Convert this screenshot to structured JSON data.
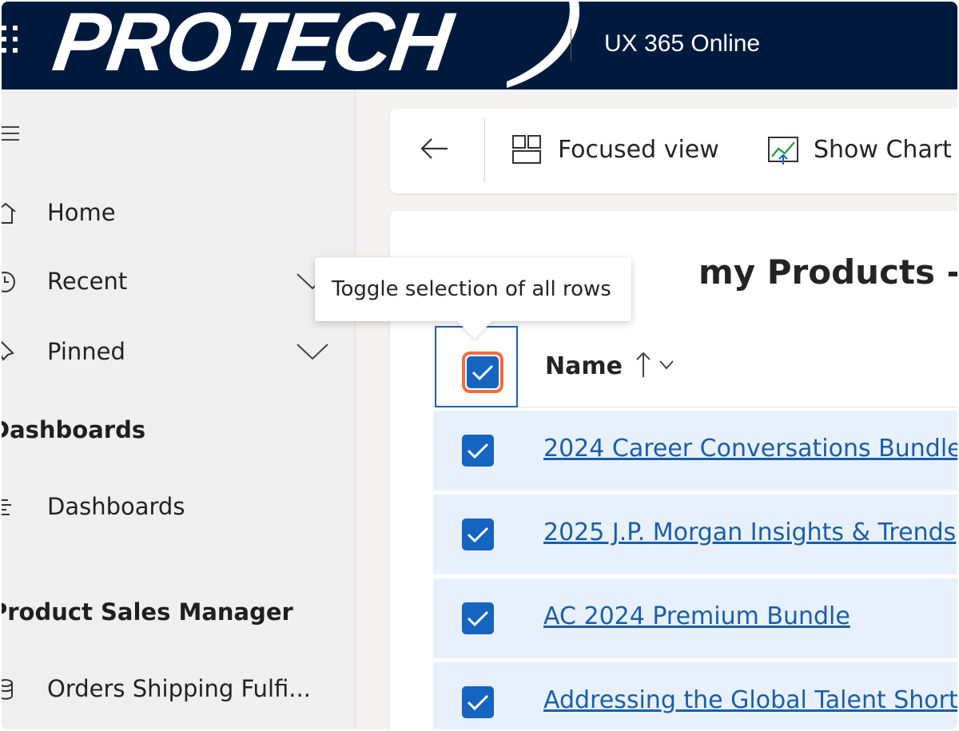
{
  "topbar": {
    "logo_text": "PROTECH",
    "app_title": "UX 365 Online"
  },
  "sidebar": {
    "items": [
      {
        "label": "Home",
        "icon": "home-icon"
      },
      {
        "label": "Recent",
        "icon": "clock-icon"
      },
      {
        "label": "Pinned",
        "icon": "pin-icon"
      }
    ],
    "sections": [
      {
        "title": "Dashboards",
        "items": [
          {
            "label": "Dashboards",
            "icon": "dashboard-icon"
          }
        ]
      },
      {
        "title": "Product Sales Manager",
        "items": [
          {
            "label": "Orders Shipping Fulfi...",
            "icon": "cylinder-icon"
          }
        ]
      }
    ]
  },
  "commandbar": {
    "focused_view_label": "Focused view",
    "show_chart_label": "Show Chart"
  },
  "grid": {
    "view_title": "my Products - for",
    "header_name": "Name",
    "rows": [
      {
        "name": "2024 Career Conversations Bundle",
        "selected": true
      },
      {
        "name": "2025 J.P. Morgan Insights & Trends",
        "selected": true
      },
      {
        "name": "AC 2024 Premium Bundle",
        "selected": true
      },
      {
        "name": "Addressing the Global Talent Shortage",
        "selected": true
      }
    ]
  },
  "tooltip": {
    "text": "Toggle selection of all rows"
  },
  "colors": {
    "topbar": "#001a3d",
    "accent": "#1565c0",
    "link": "#1a5ea8",
    "focus_ring": "#f26c3a",
    "row_selected": "#e8f1fb"
  }
}
